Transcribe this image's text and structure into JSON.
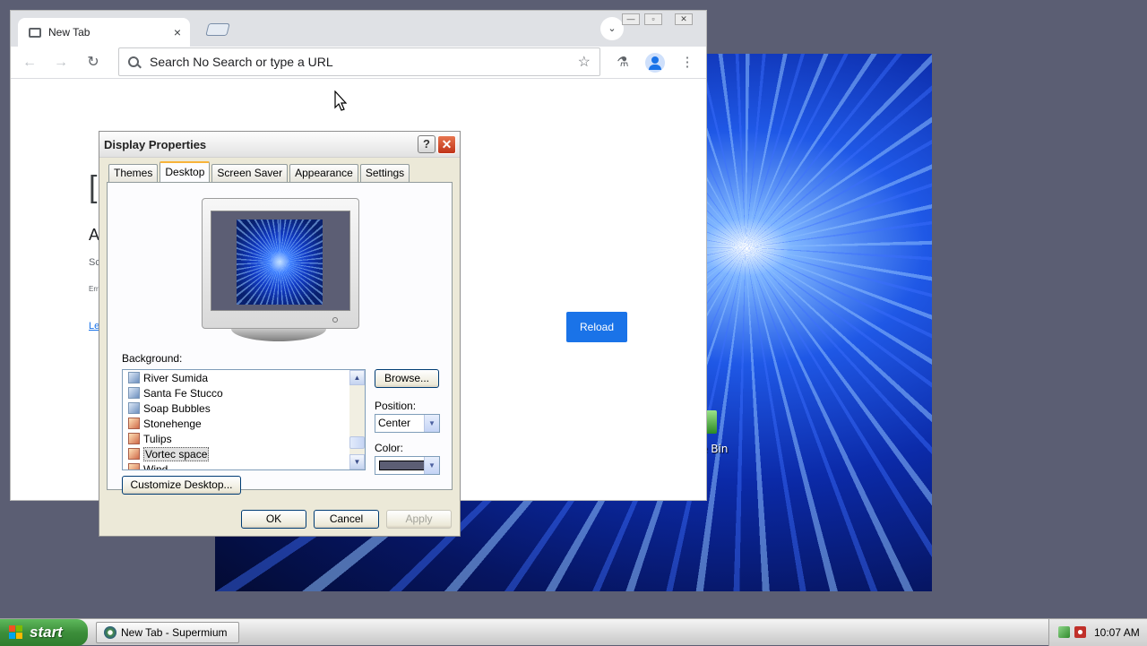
{
  "desktop": {
    "recycle_bin_label": "e Bin"
  },
  "browser": {
    "tab": {
      "title": "New Tab",
      "close_glyph": "×",
      "favicon": "tab-page-icon"
    },
    "tab_search_glyph": "⌄",
    "window_controls": {
      "minimize": "—",
      "maximize": "▫",
      "close": "✕"
    },
    "toolbar": {
      "back_glyph": "←",
      "forward_glyph": "→",
      "reload_glyph": "↻",
      "omnibox_text": "Search No Search or type a URL",
      "star_glyph": "☆",
      "labs_glyph": "⚗",
      "menu_glyph": "⋮"
    },
    "page": {
      "fragments": [
        "[",
        "A",
        "Sc",
        "Err",
        "Le"
      ],
      "reload_label": "Reload"
    }
  },
  "dialog": {
    "title": "Display Properties",
    "help_glyph": "?",
    "close_glyph": "✕",
    "tabs": [
      {
        "label": "Themes",
        "active": false
      },
      {
        "label": "Desktop",
        "active": true
      },
      {
        "label": "Screen Saver",
        "active": false
      },
      {
        "label": "Appearance",
        "active": false
      },
      {
        "label": "Settings",
        "active": false
      }
    ],
    "background_label": "Background:",
    "background_items": [
      {
        "label": "River Sumida",
        "icon": "jpg"
      },
      {
        "label": "Santa Fe Stucco",
        "icon": "jpg"
      },
      {
        "label": "Soap Bubbles",
        "icon": "jpg"
      },
      {
        "label": "Stonehenge",
        "icon": "bmp"
      },
      {
        "label": "Tulips",
        "icon": "bmp"
      },
      {
        "label": "Vortec space",
        "icon": "bmp",
        "selected": true
      },
      {
        "label": "Wind",
        "icon": "bmp"
      }
    ],
    "browse_label": "Browse...",
    "position_label": "Position:",
    "position_value": "Center",
    "color_label": "Color:",
    "color_value_hex": "#5c5e74",
    "customize_label": "Customize Desktop...",
    "ok_label": "OK",
    "cancel_label": "Cancel",
    "apply_label": "Apply"
  },
  "taskbar": {
    "start_label": "start",
    "task_label": "New Tab - Supermium",
    "clock": "10:07 AM"
  }
}
